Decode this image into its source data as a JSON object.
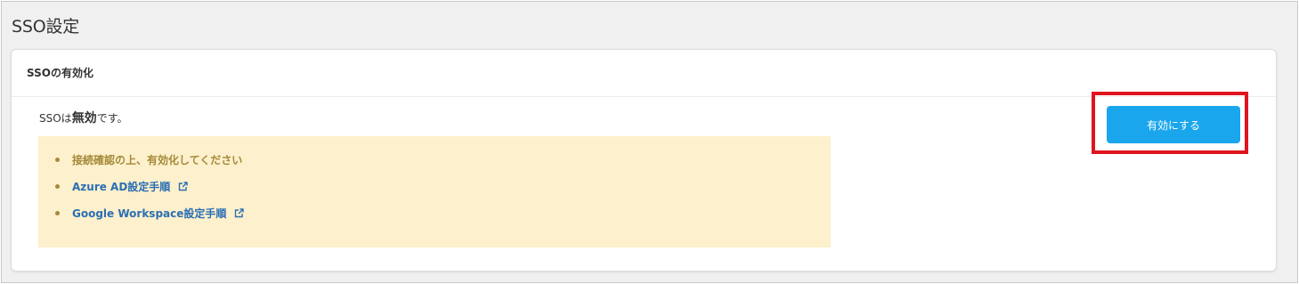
{
  "page": {
    "title": "SSO設定"
  },
  "card": {
    "title": "SSOの有効化",
    "status": {
      "prefix": "SSOは",
      "value": "無効",
      "suffix": "です。"
    },
    "notice": {
      "message": "接続確認の上、有効化してください",
      "links": [
        {
          "label": "Azure AD設定手順",
          "icon": "external-link-icon"
        },
        {
          "label": "Google Workspace設定手順",
          "icon": "external-link-icon"
        }
      ]
    },
    "enable_button": {
      "label": "有効にする"
    }
  },
  "colors": {
    "accent": "#1aa6ec",
    "highlight": "#e0141f",
    "notice_bg": "#fdf0cc",
    "notice_text": "#a58a3a",
    "link": "#2b6fb4"
  }
}
